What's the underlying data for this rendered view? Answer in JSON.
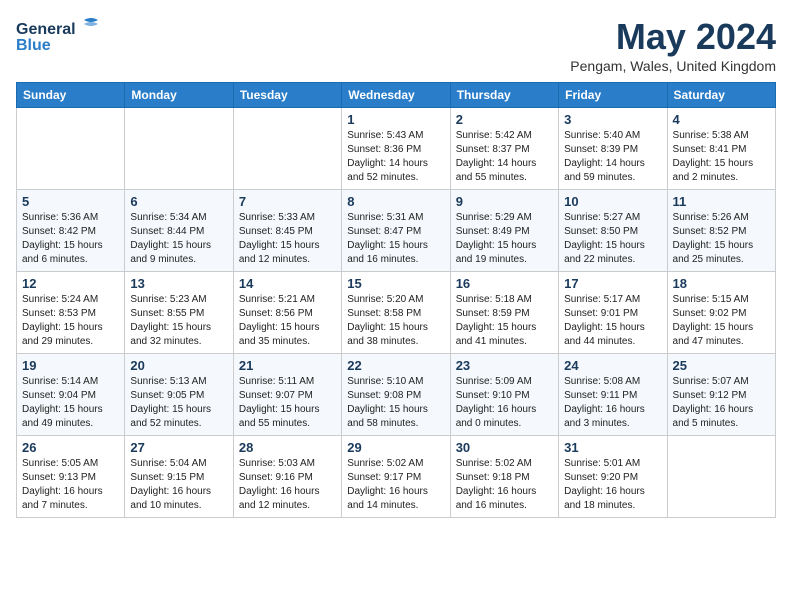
{
  "logo": {
    "line1": "General",
    "line2": "Blue"
  },
  "title": "May 2024",
  "location": "Pengam, Wales, United Kingdom",
  "weekdays": [
    "Sunday",
    "Monday",
    "Tuesday",
    "Wednesday",
    "Thursday",
    "Friday",
    "Saturday"
  ],
  "weeks": [
    [
      {
        "day": "",
        "info": ""
      },
      {
        "day": "",
        "info": ""
      },
      {
        "day": "",
        "info": ""
      },
      {
        "day": "1",
        "info": "Sunrise: 5:43 AM\nSunset: 8:36 PM\nDaylight: 14 hours and 52 minutes."
      },
      {
        "day": "2",
        "info": "Sunrise: 5:42 AM\nSunset: 8:37 PM\nDaylight: 14 hours and 55 minutes."
      },
      {
        "day": "3",
        "info": "Sunrise: 5:40 AM\nSunset: 8:39 PM\nDaylight: 14 hours and 59 minutes."
      },
      {
        "day": "4",
        "info": "Sunrise: 5:38 AM\nSunset: 8:41 PM\nDaylight: 15 hours and 2 minutes."
      }
    ],
    [
      {
        "day": "5",
        "info": "Sunrise: 5:36 AM\nSunset: 8:42 PM\nDaylight: 15 hours and 6 minutes."
      },
      {
        "day": "6",
        "info": "Sunrise: 5:34 AM\nSunset: 8:44 PM\nDaylight: 15 hours and 9 minutes."
      },
      {
        "day": "7",
        "info": "Sunrise: 5:33 AM\nSunset: 8:45 PM\nDaylight: 15 hours and 12 minutes."
      },
      {
        "day": "8",
        "info": "Sunrise: 5:31 AM\nSunset: 8:47 PM\nDaylight: 15 hours and 16 minutes."
      },
      {
        "day": "9",
        "info": "Sunrise: 5:29 AM\nSunset: 8:49 PM\nDaylight: 15 hours and 19 minutes."
      },
      {
        "day": "10",
        "info": "Sunrise: 5:27 AM\nSunset: 8:50 PM\nDaylight: 15 hours and 22 minutes."
      },
      {
        "day": "11",
        "info": "Sunrise: 5:26 AM\nSunset: 8:52 PM\nDaylight: 15 hours and 25 minutes."
      }
    ],
    [
      {
        "day": "12",
        "info": "Sunrise: 5:24 AM\nSunset: 8:53 PM\nDaylight: 15 hours and 29 minutes."
      },
      {
        "day": "13",
        "info": "Sunrise: 5:23 AM\nSunset: 8:55 PM\nDaylight: 15 hours and 32 minutes."
      },
      {
        "day": "14",
        "info": "Sunrise: 5:21 AM\nSunset: 8:56 PM\nDaylight: 15 hours and 35 minutes."
      },
      {
        "day": "15",
        "info": "Sunrise: 5:20 AM\nSunset: 8:58 PM\nDaylight: 15 hours and 38 minutes."
      },
      {
        "day": "16",
        "info": "Sunrise: 5:18 AM\nSunset: 8:59 PM\nDaylight: 15 hours and 41 minutes."
      },
      {
        "day": "17",
        "info": "Sunrise: 5:17 AM\nSunset: 9:01 PM\nDaylight: 15 hours and 44 minutes."
      },
      {
        "day": "18",
        "info": "Sunrise: 5:15 AM\nSunset: 9:02 PM\nDaylight: 15 hours and 47 minutes."
      }
    ],
    [
      {
        "day": "19",
        "info": "Sunrise: 5:14 AM\nSunset: 9:04 PM\nDaylight: 15 hours and 49 minutes."
      },
      {
        "day": "20",
        "info": "Sunrise: 5:13 AM\nSunset: 9:05 PM\nDaylight: 15 hours and 52 minutes."
      },
      {
        "day": "21",
        "info": "Sunrise: 5:11 AM\nSunset: 9:07 PM\nDaylight: 15 hours and 55 minutes."
      },
      {
        "day": "22",
        "info": "Sunrise: 5:10 AM\nSunset: 9:08 PM\nDaylight: 15 hours and 58 minutes."
      },
      {
        "day": "23",
        "info": "Sunrise: 5:09 AM\nSunset: 9:10 PM\nDaylight: 16 hours and 0 minutes."
      },
      {
        "day": "24",
        "info": "Sunrise: 5:08 AM\nSunset: 9:11 PM\nDaylight: 16 hours and 3 minutes."
      },
      {
        "day": "25",
        "info": "Sunrise: 5:07 AM\nSunset: 9:12 PM\nDaylight: 16 hours and 5 minutes."
      }
    ],
    [
      {
        "day": "26",
        "info": "Sunrise: 5:05 AM\nSunset: 9:13 PM\nDaylight: 16 hours and 7 minutes."
      },
      {
        "day": "27",
        "info": "Sunrise: 5:04 AM\nSunset: 9:15 PM\nDaylight: 16 hours and 10 minutes."
      },
      {
        "day": "28",
        "info": "Sunrise: 5:03 AM\nSunset: 9:16 PM\nDaylight: 16 hours and 12 minutes."
      },
      {
        "day": "29",
        "info": "Sunrise: 5:02 AM\nSunset: 9:17 PM\nDaylight: 16 hours and 14 minutes."
      },
      {
        "day": "30",
        "info": "Sunrise: 5:02 AM\nSunset: 9:18 PM\nDaylight: 16 hours and 16 minutes."
      },
      {
        "day": "31",
        "info": "Sunrise: 5:01 AM\nSunset: 9:20 PM\nDaylight: 16 hours and 18 minutes."
      },
      {
        "day": "",
        "info": ""
      }
    ]
  ]
}
